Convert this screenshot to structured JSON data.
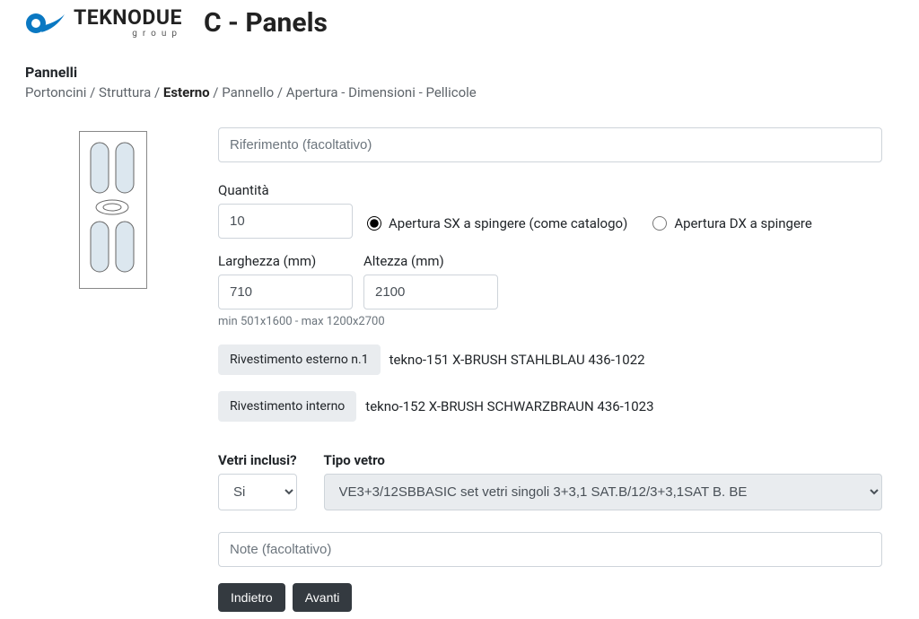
{
  "brand": {
    "name": "TEKNODUE",
    "sub": "group"
  },
  "page_title": "C - Panels",
  "breadcrumb": {
    "title": "Pannelli",
    "items": [
      "Portoncini",
      "Struttura",
      "Esterno",
      "Pannello",
      "Apertura - Dimensioni - Pellicole"
    ],
    "active_index": 2
  },
  "riferimento": {
    "placeholder": "Riferimento (facoltativo)",
    "value": ""
  },
  "quantita": {
    "label": "Quantità",
    "value": "10"
  },
  "apertura": {
    "options": [
      {
        "label": "Apertura SX a spingere (come catalogo)",
        "checked": true
      },
      {
        "label": "Apertura DX a spingere",
        "checked": false
      }
    ]
  },
  "larghezza": {
    "label": "Larghezza (mm)",
    "value": "710"
  },
  "altezza": {
    "label": "Altezza (mm)",
    "value": "2100"
  },
  "dim_hint": "min 501x1600 - max 1200x2700",
  "coatings": [
    {
      "button": "Rivestimento esterno n.1",
      "value": "tekno-151 X-BRUSH STAHLBLAU 436-1022"
    },
    {
      "button": "Rivestimento interno",
      "value": "tekno-152 X-BRUSH SCHWARZBRAUN 436-1023"
    }
  ],
  "glass": {
    "included_label": "Vetri inclusi?",
    "included_value": "Si",
    "type_label": "Tipo vetro",
    "type_value": "VE3+3/12SBBASIC set vetri singoli 3+3,1 SAT.B/12/3+3,1SAT B. BE"
  },
  "note": {
    "placeholder": "Note (facoltativo)",
    "value": ""
  },
  "nav": {
    "back": "Indietro",
    "next": "Avanti"
  }
}
